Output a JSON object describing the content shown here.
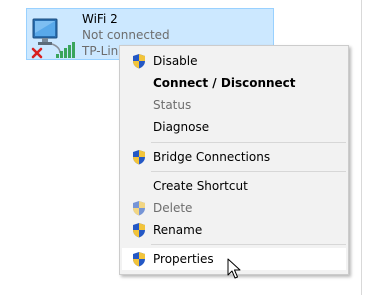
{
  "adapter": {
    "name": "WiFi 2",
    "status": "Not connected",
    "device": "TP-Link",
    "icon": "network-adapter-icon",
    "status_icon": "red-x-icon",
    "signal_icon": "wifi-signal-icon"
  },
  "menu": {
    "items": [
      {
        "label": "Disable",
        "shield": true
      },
      {
        "label": "Connect / Disconnect",
        "bold": true
      },
      {
        "label": "Status",
        "disabled": true
      },
      {
        "label": "Diagnose"
      },
      {
        "label": "Bridge Connections",
        "shield": true
      },
      {
        "label": "Create Shortcut"
      },
      {
        "label": "Delete",
        "shield": true,
        "disabled": true
      },
      {
        "label": "Rename",
        "shield": true
      },
      {
        "label": "Properties",
        "shield": true,
        "hovered": true
      }
    ]
  },
  "colors": {
    "selection_bg": "#cce8ff",
    "selection_border": "#99d1ff",
    "menu_bg": "#f2f2f2",
    "menu_hover": "#ffffff",
    "disabled_text": "#6d6d6d"
  }
}
